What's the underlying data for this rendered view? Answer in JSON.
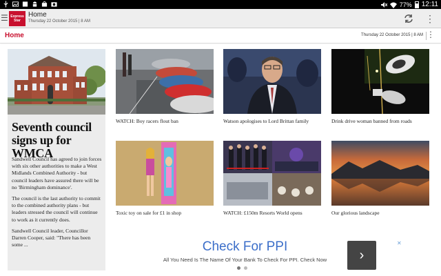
{
  "status_bar": {
    "battery": "77%",
    "time": "12:11"
  },
  "app_bar": {
    "logo_line1": "Express",
    "logo_line2": "Star",
    "title": "Home",
    "subtitle": "Thursday 22 October 2015 | 8 AM"
  },
  "section": {
    "title": "Home",
    "date": "Thursday 22 October 2015 | 8 AM"
  },
  "lead_story": {
    "headline": "Seventh council signs up for WMCA",
    "paragraphs": [
      "Sandwell Council has agreed to join forces with six other authorities to make a West Midlands Combined Authority - but council leaders have assured there will be no 'Birmingham dominance'.",
      "The council is the last authority to commit to the combined authority plans - but leaders stressed the council will continue to work as it currently does.",
      "Sandwell Council leader, Councillor Darren Cooper, said: \"There has been some ..."
    ]
  },
  "tiles": [
    {
      "caption": "WATCH: Boy racers flout ban"
    },
    {
      "caption": "Watson apologises to Lord Brittan family"
    },
    {
      "caption": "Drink drive woman banned from roads"
    },
    {
      "caption": "Toxic toy on sale for £1 in shop"
    },
    {
      "caption": "WATCH: £150m Resorts World opens"
    },
    {
      "caption": "Our glorious landscape"
    }
  ],
  "ad": {
    "title": "Check For PPI",
    "subtitle": "All You Need Is The Name Of Your Bank To Check For PPI. Check Now",
    "arrow": "›",
    "close": "✕"
  },
  "colors": {
    "brand": "#c8102e",
    "ad_title": "#3b6ec9"
  }
}
